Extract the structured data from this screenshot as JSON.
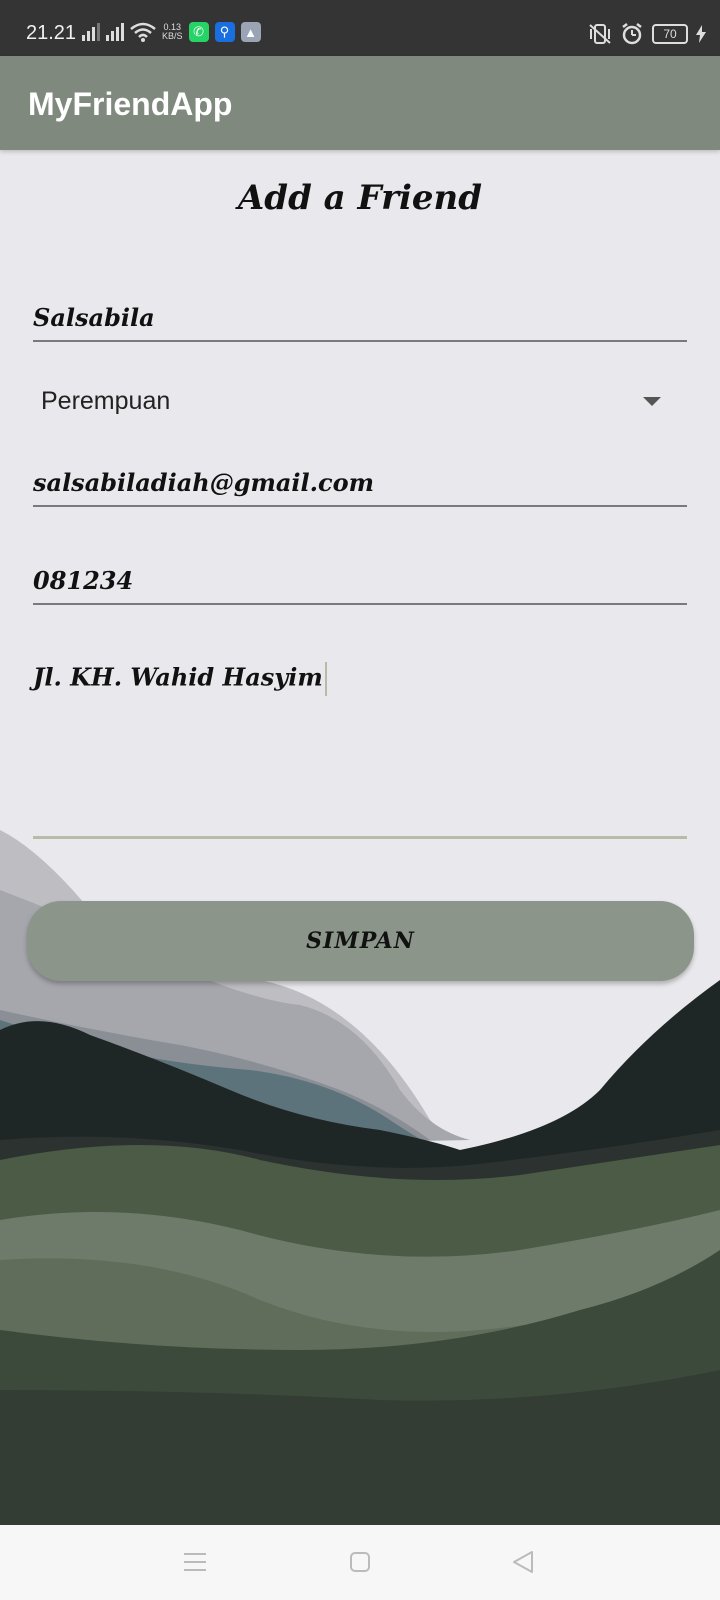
{
  "status_bar": {
    "time": "21.21",
    "net_speed_value": "0.13",
    "net_speed_unit": "KB/S",
    "battery": "70"
  },
  "app_bar": {
    "title": "MyFriendApp"
  },
  "form": {
    "title": "Add a Friend",
    "name_value": "Salsabila",
    "gender_selected": "Perempuan",
    "email_value": "salsabiladiah@gmail.com",
    "phone_value": "081234",
    "address_value": "Jl. KH. Wahid Hasyim",
    "save_label": "SIMPAN"
  },
  "colors": {
    "app_bar": "#7f897d",
    "button": "#8b958a",
    "background": "#e9e8ec"
  },
  "icons": [
    "signal-icon",
    "wifi-icon",
    "whatsapp-icon",
    "usb-icon",
    "app-notification-icon",
    "vibrate-icon",
    "alarm-icon",
    "battery-icon",
    "charging-icon",
    "menu-icon",
    "home-icon",
    "back-icon"
  ]
}
